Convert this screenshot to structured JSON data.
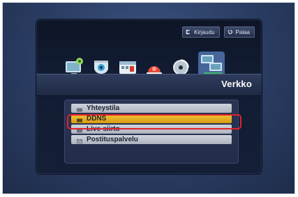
{
  "topbar": {
    "login_label": "Kirjaudu",
    "back_label": "Palaa"
  },
  "icons": [
    {
      "name": "monitor-gear-icon"
    },
    {
      "name": "camera-icon"
    },
    {
      "name": "calendar-icon"
    },
    {
      "name": "alarm-icon"
    },
    {
      "name": "disc-icon"
    },
    {
      "name": "network-icon",
      "selected": true
    }
  ],
  "title": "Verkko",
  "menu": {
    "items": [
      {
        "label": "Yhteystila"
      },
      {
        "label": "DDNS",
        "selected": true
      },
      {
        "label": "Live-siirto"
      },
      {
        "label": "Postituspalvelu"
      }
    ]
  },
  "colors": {
    "accent": "#f2b820",
    "highlight": "#e1212a"
  }
}
